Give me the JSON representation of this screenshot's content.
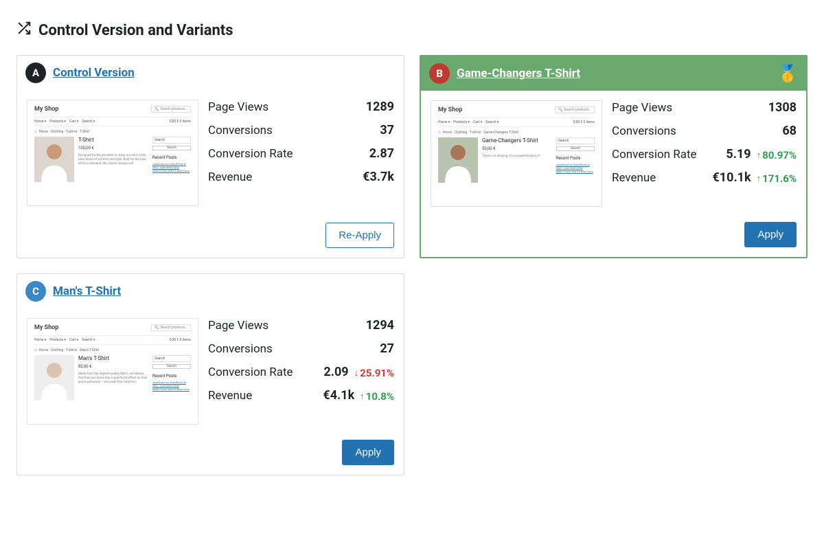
{
  "page": {
    "title": "Control Version and Variants"
  },
  "variants": [
    {
      "badge_letter": "A",
      "title": "Control Version",
      "is_winner": false,
      "thumb": {
        "shop_name": "My Shop",
        "search_placeholder": "Search products…",
        "nav": [
          "Home",
          "Products",
          "Cart",
          "Search"
        ],
        "nav_right": "0,00 €   0 items",
        "breadcrumbs": "Home · Clothing · T-shirts · T-Shirt",
        "product_title": "T-Shirt",
        "price": "100,00 €",
        "blurb": "Designed for the jet-setter in mind, our shirt is the ideal blend of comfort and style. Built for the man who's in demand, this classic design will",
        "sidebar_search": "Search",
        "sidebar_btn": "Search",
        "recent_posts_title": "Recent Posts",
        "recent_posts_item": "JavaScript on WordPress is\nWild… and Here's Why\nNelio Forms and Its New Form"
      },
      "stats": {
        "page_views_label": "Page Views",
        "page_views_value": "1289",
        "conversions_label": "Conversions",
        "conversions_value": "37",
        "conv_rate_label": "Conversion Rate",
        "conv_rate_value": "2.87",
        "conv_rate_delta": "",
        "conv_rate_dir": "",
        "revenue_label": "Revenue",
        "revenue_value": "€3.7k",
        "revenue_delta": "",
        "revenue_dir": ""
      },
      "action_label": "Re-Apply",
      "action_style": "outline"
    },
    {
      "badge_letter": "B",
      "title": "Game-Changers T-Shirt",
      "is_winner": true,
      "thumb": {
        "shop_name": "My Shop",
        "search_placeholder": "Search products…",
        "nav": [
          "Home",
          "Products",
          "Cart",
          "Search"
        ],
        "nav_right": "0,00 €   0 items",
        "breadcrumbs": "Home · Clothing · T-shirts · Game-Changers T-Shirt",
        "product_title": "Game-Changers T-Shirt",
        "price": "50,00 €",
        "blurb": "There's no denying, it's a powerful piece of",
        "sidebar_search": "Search",
        "sidebar_btn": "Search",
        "recent_posts_title": "Recent Posts",
        "recent_posts_item": "JavaScript on WordPress is\nWild… and Here's Why\nNelio Forms and Its New Form"
      },
      "stats": {
        "page_views_label": "Page Views",
        "page_views_value": "1308",
        "conversions_label": "Conversions",
        "conversions_value": "68",
        "conv_rate_label": "Conversion Rate",
        "conv_rate_value": "5.19",
        "conv_rate_delta": "80.97%",
        "conv_rate_dir": "up",
        "revenue_label": "Revenue",
        "revenue_value": "€10.1k",
        "revenue_delta": "171.6%",
        "revenue_dir": "up"
      },
      "action_label": "Apply",
      "action_style": "primary"
    },
    {
      "badge_letter": "C",
      "title": "Man's T-Shirt",
      "is_winner": false,
      "thumb": {
        "shop_name": "My Shop",
        "search_placeholder": "Search products…",
        "nav": [
          "Home",
          "Products",
          "Cart",
          "Search"
        ],
        "nav_right": "0,00 €   0 items",
        "breadcrumbs": "Home · Clothing · T-shirts · Man's T-Shirt",
        "product_title": "Man's T-Shirt",
        "price": "82,00 €",
        "blurb": "Made from the highest-quality fabric, we believe that how you dress has a significant effect on how you're perceived – we made this t-shirt for",
        "sidebar_search": "Search",
        "sidebar_btn": "Search",
        "recent_posts_title": "Recent Posts",
        "recent_posts_item": "JavaScript on WordPress is\nWild… and Here's Why\nNelio Forms and Its New Form"
      },
      "stats": {
        "page_views_label": "Page Views",
        "page_views_value": "1294",
        "conversions_label": "Conversions",
        "conversions_value": "27",
        "conv_rate_label": "Conversion Rate",
        "conv_rate_value": "2.09",
        "conv_rate_delta": "25.91%",
        "conv_rate_dir": "down",
        "revenue_label": "Revenue",
        "revenue_value": "€4.1k",
        "revenue_delta": "10.8%",
        "revenue_dir": "up"
      },
      "action_label": "Apply",
      "action_style": "primary"
    }
  ]
}
